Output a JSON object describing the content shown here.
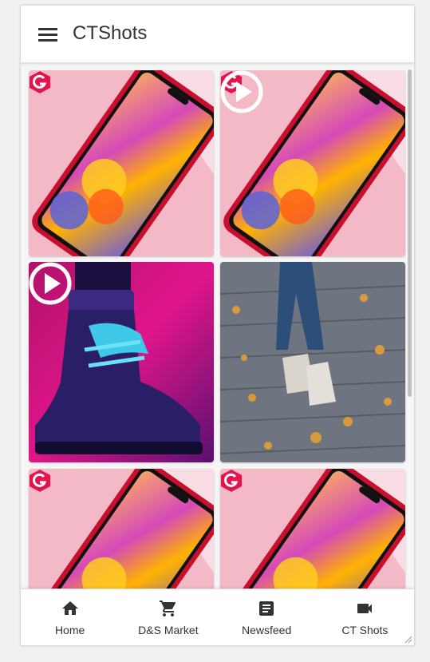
{
  "app": {
    "title": "CTShots"
  },
  "grid": {
    "tiles": [
      {
        "kind": "phone",
        "has_badge": true,
        "has_play": false
      },
      {
        "kind": "phone",
        "has_badge": true,
        "has_play": true
      },
      {
        "kind": "boot",
        "has_badge": false,
        "has_play": true
      },
      {
        "kind": "street",
        "has_badge": false,
        "has_play": false
      },
      {
        "kind": "phone",
        "has_badge": true,
        "has_play": true
      },
      {
        "kind": "phone",
        "has_badge": true,
        "has_play": true
      }
    ]
  },
  "bottom_nav": {
    "items": [
      {
        "label": "Home",
        "icon": "home-icon"
      },
      {
        "label": "D&S Market",
        "icon": "cart-icon"
      },
      {
        "label": "Newsfeed",
        "icon": "article-icon"
      },
      {
        "label": "CT Shots",
        "icon": "videocam-icon"
      }
    ]
  },
  "colors": {
    "accent": "#e4144e",
    "text": "#333333",
    "tile_bg_pink": "#f2b6c2"
  }
}
